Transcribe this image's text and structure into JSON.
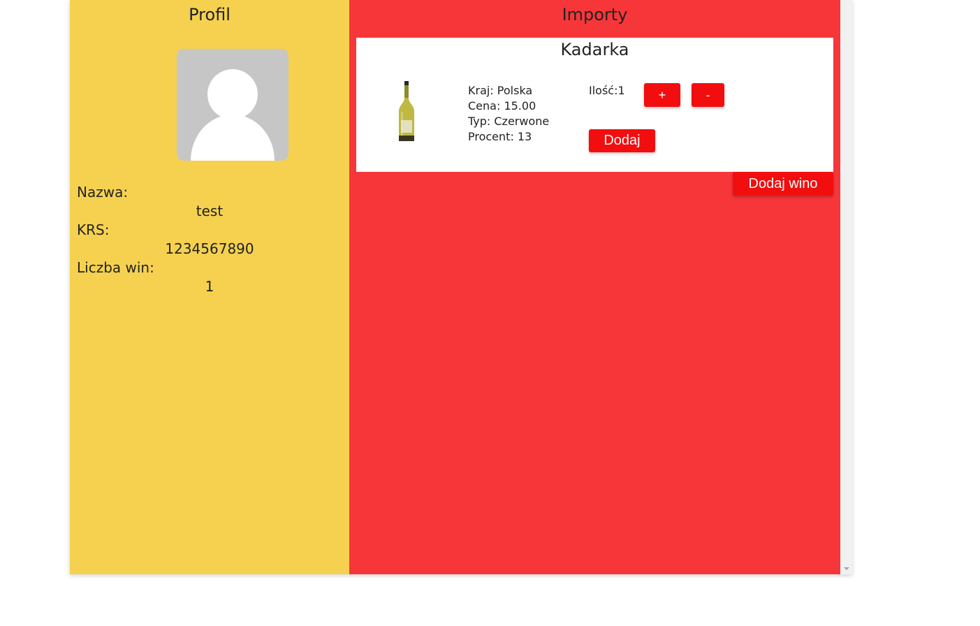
{
  "profile": {
    "title": "Profil",
    "avatar_icon": "user-silhouette-icon",
    "name_label": "Nazwa:",
    "name_value": "test",
    "krs_label": "KRS:",
    "krs_value": "1234567890",
    "wine_count_label": "Liczba win:",
    "wine_count_value": "1"
  },
  "imports": {
    "title": "Importy",
    "wines": [
      {
        "name": "Kadarka",
        "image_icon": "wine-bottle-icon",
        "country": "Kraj: Polska",
        "price": "Cena: 15.00",
        "type": "Typ: Czerwone",
        "percent": "Procent: 13",
        "quantity": "Ilość:1",
        "plus_label": "+",
        "minus_label": "-",
        "add_label": "Dodaj"
      }
    ],
    "add_wine_label": "Dodaj wino"
  },
  "colors": {
    "profile_bg": "#f5d14f",
    "imports_bg": "#f73639",
    "button_bg": "#f20d0e",
    "avatar_bg": "#c6c6c6"
  }
}
